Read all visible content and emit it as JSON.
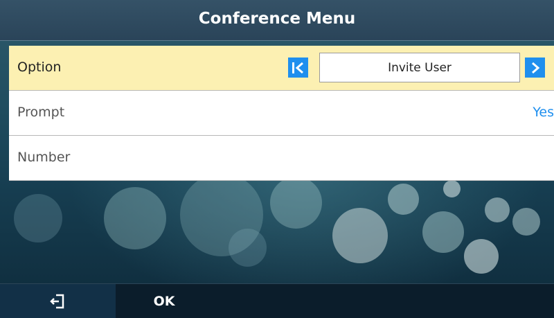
{
  "header": {
    "title": "Conference Menu"
  },
  "rows": [
    {
      "label": "Option",
      "value": "Invite User"
    },
    {
      "label": "Prompt",
      "value": "Yes"
    },
    {
      "label": "Number",
      "value": ""
    }
  ],
  "softkeys": {
    "back_icon": "exit-icon",
    "ok_label": "OK"
  },
  "colors": {
    "accent": "#1f8fee",
    "selected_row": "#fcf0b2",
    "title_bar": "#2f4b60",
    "softkey_bar": "#0b1d2b"
  }
}
